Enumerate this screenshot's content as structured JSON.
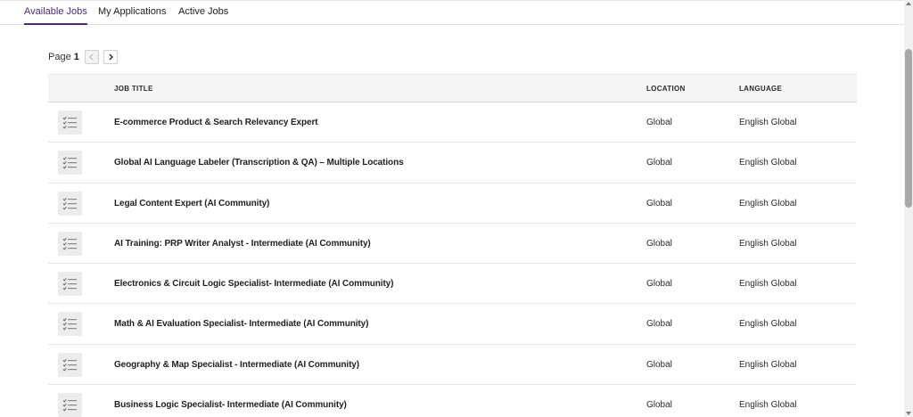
{
  "tabs": [
    {
      "label": "Available Jobs",
      "active": true
    },
    {
      "label": "My Applications",
      "active": false
    },
    {
      "label": "Active Jobs",
      "active": false
    }
  ],
  "pagination": {
    "label": "Page",
    "current": "1",
    "prev_icon": "chevron-left-icon",
    "next_icon": "chevron-right-icon"
  },
  "table": {
    "headers": {
      "title": "JOB TITLE",
      "location": "LOCATION",
      "language": "LANGUAGE"
    },
    "row_icon": "checklist-icon",
    "rows": [
      {
        "title": "E-commerce Product & Search Relevancy Expert",
        "location": "Global",
        "language": "English Global"
      },
      {
        "title": "Global AI Language Labeler (Transcription & QA) – Multiple Locations",
        "location": "Global",
        "language": "English Global"
      },
      {
        "title": "Legal Content Expert (AI Community)",
        "location": "Global",
        "language": "English Global"
      },
      {
        "title": "AI Training: PRP Writer Analyst - Intermediate (AI Community)",
        "location": "Global",
        "language": "English Global"
      },
      {
        "title": "Electronics & Circuit Logic Specialist- Intermediate (AI Community)",
        "location": "Global",
        "language": "English Global"
      },
      {
        "title": "Math & AI Evaluation Specialist- Intermediate (AI Community)",
        "location": "Global",
        "language": "English Global"
      },
      {
        "title": "Geography & Map Specialist - Intermediate (AI Community)",
        "location": "Global",
        "language": "English Global"
      },
      {
        "title": "Business Logic Specialist- Intermediate (AI Community)",
        "location": "Global",
        "language": "English Global"
      }
    ]
  },
  "colors": {
    "accent": "#4b2a78",
    "header_bg": "#f5f5f5",
    "icon_bg": "#ececec"
  }
}
